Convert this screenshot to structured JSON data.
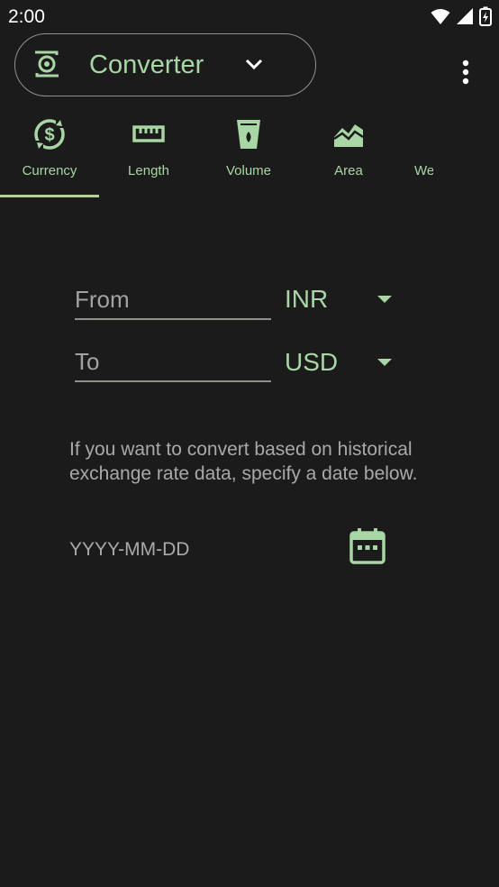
{
  "status_bar": {
    "time": "2:00",
    "icons": [
      "wifi-icon",
      "signal-icon",
      "battery-icon"
    ]
  },
  "app_bar": {
    "selector_label": "Converter",
    "selector_icon": "converter-icon",
    "chevron_icon": "chevron-down-icon",
    "menu_icon": "more-vert-icon"
  },
  "tabs": [
    {
      "label": "Currency",
      "icon": "currency-icon",
      "selected": true
    },
    {
      "label": "Length",
      "icon": "ruler-icon",
      "selected": false
    },
    {
      "label": "Volume",
      "icon": "cup-icon",
      "selected": false
    },
    {
      "label": "Area",
      "icon": "area-icon",
      "selected": false
    },
    {
      "label": "We",
      "icon": "",
      "selected": false
    }
  ],
  "form": {
    "from": {
      "placeholder": "From",
      "unit": "INR"
    },
    "to": {
      "placeholder": "To",
      "unit": "USD"
    },
    "hint": "If you want to convert based on historical exchange rate data, specify a date below.",
    "date_placeholder": "YYYY-MM-DD",
    "calendar_icon": "calendar-icon"
  },
  "colors": {
    "background": "#1b1b1b",
    "accent": "#a8d6a4",
    "indicator": "#b6cf98",
    "muted_text": "#a9a9a9"
  }
}
